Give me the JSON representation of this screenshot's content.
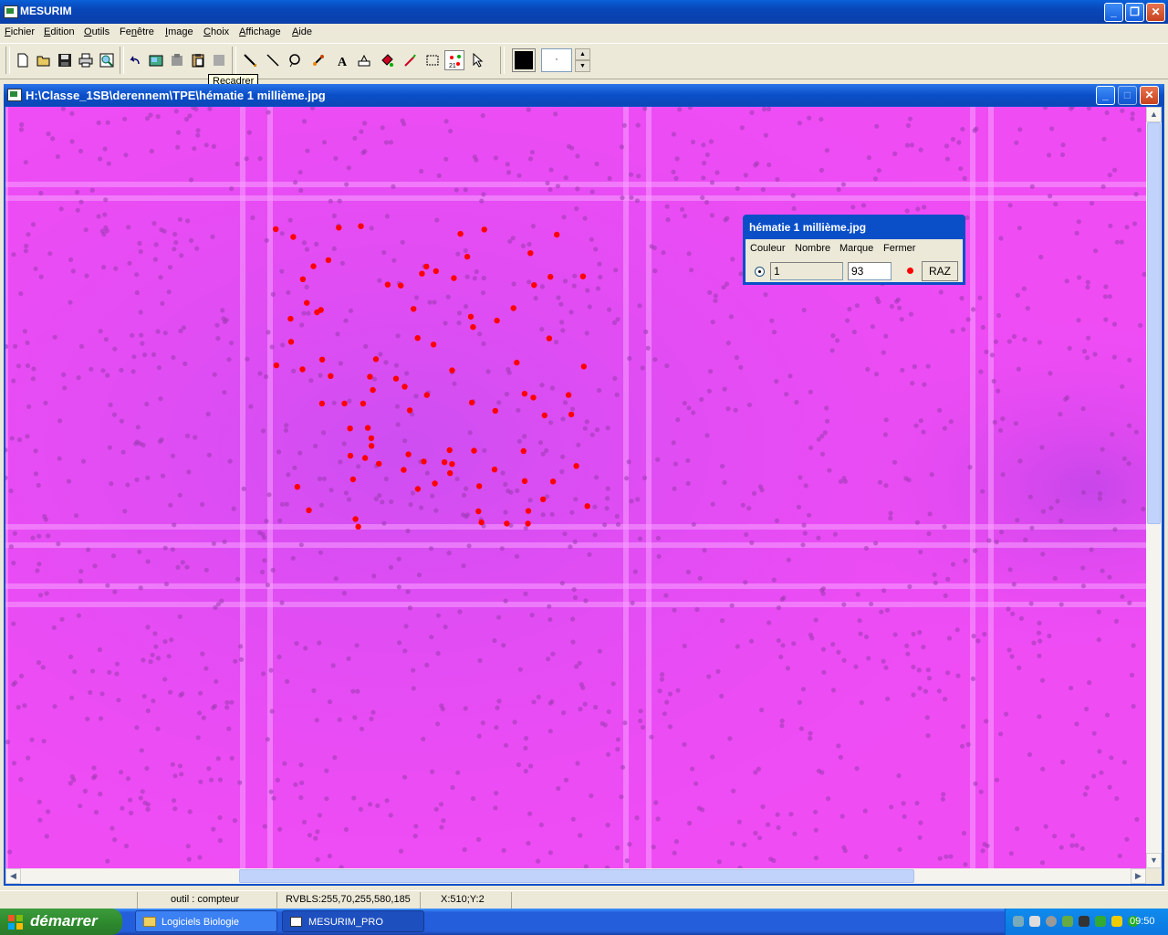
{
  "app": {
    "title": "MESURIM"
  },
  "menu": {
    "items": [
      {
        "label": "Fichier",
        "u": "F",
        "rest": "ichier"
      },
      {
        "label": "Edition",
        "u": "E",
        "rest": "dition"
      },
      {
        "label": "Outils",
        "u": "O",
        "rest": "utils"
      },
      {
        "label": "Fenêtre",
        "pre": "Fe",
        "u": "n",
        "rest": "être"
      },
      {
        "label": "Image",
        "u": "I",
        "rest": "mage"
      },
      {
        "label": "Choix",
        "u": "C",
        "rest": "hoix"
      },
      {
        "label": "Affichage",
        "u": "A",
        "rest": "ffichage"
      },
      {
        "label": "Aide",
        "u": "A",
        "rest": "ide"
      }
    ]
  },
  "toolbar": {
    "tooltip": "Recadrer",
    "buttons": [
      "new-file-icon",
      "open-folder-icon",
      "save-icon",
      "print-icon",
      "print-preview-icon",
      "undo-icon",
      "copy-image-icon",
      "paste-image-icon",
      "clipboard-icon",
      "crop-icon",
      "pencil-icon",
      "line-icon",
      "lasso-icon",
      "eyedropper-icon",
      "text-icon",
      "fill-area-icon",
      "fill-bucket-icon",
      "brush-icon",
      "select-rect-icon",
      "counter-icon",
      "pointer-icon"
    ],
    "color": "#000000",
    "line_width": "·"
  },
  "document": {
    "title": "H:\\Classe_1SB\\derennem\\TPE\\hématie 1 millième.jpg",
    "image_colors": {
      "bg": "#f04cf4",
      "grid": "#f8a0ff",
      "cell": "#9a3ab0",
      "marker": "#ff0000"
    }
  },
  "counter_dialog": {
    "title": "hématie 1 millième.jpg",
    "headers": {
      "couleur": "Couleur",
      "nombre": "Nombre",
      "marque": "Marque",
      "fermer": "Fermer"
    },
    "color_value": "1",
    "count": "93",
    "raz_label": "RAZ"
  },
  "status": {
    "tool": "outil : compteur",
    "rgb": "RVBLS:255,70,255,580,185",
    "coords": "X:510;Y:2"
  },
  "taskbar": {
    "start_label": "démarrer",
    "tasks": [
      {
        "label": "Logiciels Biologie"
      },
      {
        "label": "MESURIM_PRO"
      }
    ],
    "clock": "09:50"
  }
}
